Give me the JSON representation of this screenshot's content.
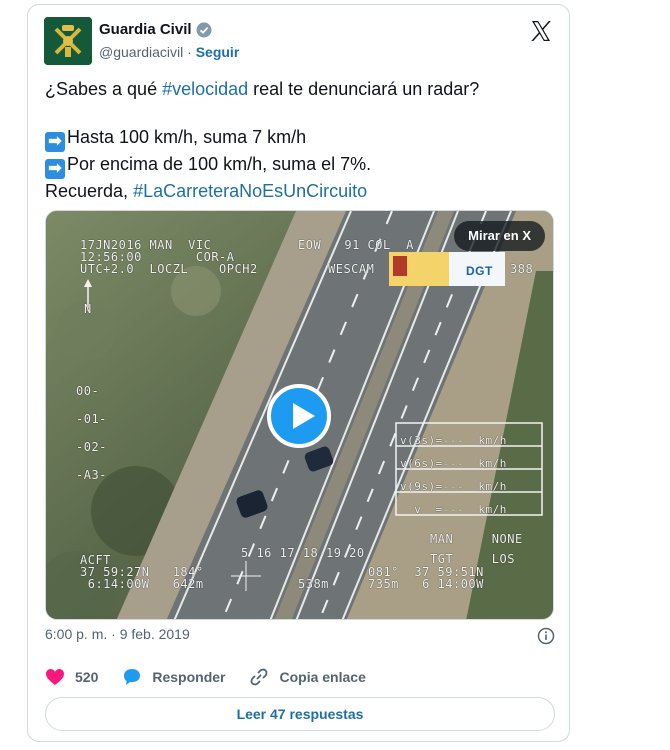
{
  "author": {
    "name": "Guardia Civil",
    "handle": "@guardiacivil",
    "separator": "·",
    "follow_label": "Seguir"
  },
  "tweet": {
    "line1_prefix": "¿Sabes a qué ",
    "line1_hashtag": "#velocidad",
    "line1_suffix": " real te denunciará un radar?",
    "line2": "Hasta 100 km/h, suma 7 km/h",
    "line3": "Por encima de 100 km/h, suma el 7%.",
    "line4_prefix": "Recuerda, ",
    "line4_hashtag": "#LaCarreteraNoEsUnCircuito",
    "arrow_glyph": "➡"
  },
  "media": {
    "watch_on_x_label": "Mirar en X",
    "osd": {
      "top_left": "17JN2016 MAN  VIC\n12:56:00       COR-A\nUTC+2.0  LOCZL    OPCH2",
      "top_mid": "EOW   91 COL  A",
      "wescam": "WESCAM",
      "num_388": "388",
      "north": "N",
      "scale": "00-\n-01-\n-02-\n-A3-",
      "speed_box": "v(3s)=---  km/h\nv(6s)=---  km/h\nv(9s)=---  km/h\n  v  =---  km/h",
      "man_none": "MAN     NONE\nTGT     LOS",
      "ticks": "5 16 17 18 19 20",
      "bottom_left": "ACFT\n37 59:27N   184°\n 6:14:00W   642m",
      "bottom_mid": "538m",
      "bottom_right": "081°  37 59:51N\n735m   6 14:00W",
      "dgt_label": "DGT"
    }
  },
  "timestamp": "6:00 p. m. · 9 feb. 2019",
  "actions": {
    "likes_count": "520",
    "reply_label": "Responder",
    "copy_link_label": "Copia enlace"
  },
  "read_replies_label": "Leer 47 respuestas",
  "colors": {
    "link": "#1d6fa5",
    "like": "#f91880",
    "reply": "#1d9bf0",
    "muted": "#536471",
    "border": "#cfd9de"
  },
  "icons": {
    "verified": "verified-badge-icon",
    "x_logo": "x-logo-icon",
    "info": "info-icon",
    "like": "heart-icon",
    "reply": "speech-bubble-icon",
    "copy_link": "link-icon",
    "play": "play-icon"
  }
}
